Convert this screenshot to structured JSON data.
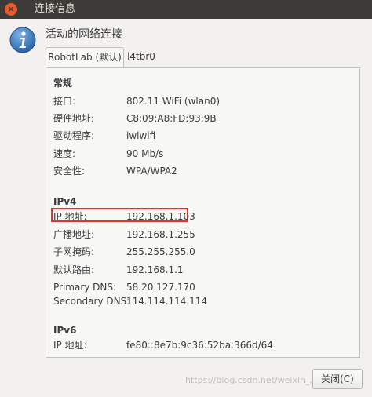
{
  "window": {
    "title": "连接信息",
    "close_glyph": "×"
  },
  "header": {
    "icon": "info-icon",
    "heading": "活动的网络连接"
  },
  "tabs": [
    {
      "label": "RobotLab (默认)",
      "active": true
    },
    {
      "label": "l4tbr0",
      "active": false
    }
  ],
  "general": {
    "title": "常规",
    "rows": [
      {
        "label": "接口:",
        "value": "802.11 WiFi (wlan0)"
      },
      {
        "label": "硬件地址:",
        "value": "C8:09:A8:FD:93:9B"
      },
      {
        "label": "驱动程序:",
        "value": "iwlwifi"
      },
      {
        "label": "速度:",
        "value": "90 Mb/s"
      },
      {
        "label": "安全性:",
        "value": "WPA/WPA2"
      }
    ]
  },
  "ipv4": {
    "title": "IPv4",
    "rows": [
      {
        "label": "IP 地址:",
        "value": "192.168.1.103"
      },
      {
        "label": "广播地址:",
        "value": "192.168.1.255"
      },
      {
        "label": "子网掩码:",
        "value": "255.255.255.0"
      },
      {
        "label": "默认路由:",
        "value": "192.168.1.1"
      },
      {
        "label": "Primary DNS:",
        "value": "58.20.127.170"
      },
      {
        "label": "Secondary DNS:",
        "value": "114.114.114.114"
      }
    ]
  },
  "ipv6": {
    "title": "IPv6",
    "rows": [
      {
        "label": "IP 地址:",
        "value": "fe80::8e7b:9c36:52ba:366d/64"
      }
    ]
  },
  "footer": {
    "close_button": "关闭(C)"
  },
  "watermark": "https://blog.csdn.net/weixin_...",
  "colors": {
    "titlebar": "#3c3b37",
    "window_close": "#e9592e",
    "info_icon": "#2f6fb3",
    "highlight": "#e0332c"
  }
}
